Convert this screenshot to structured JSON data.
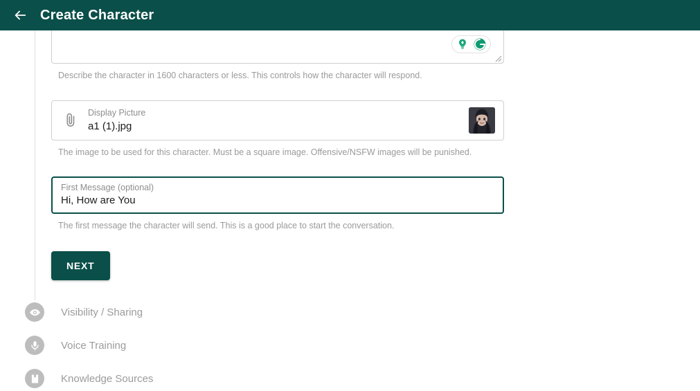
{
  "appbar": {
    "back_icon": "arrow-left-icon",
    "title": "Create Character",
    "bg_color": "#0a4f49"
  },
  "form": {
    "description": {
      "helper": "Describe the character in 1600 characters or less. This controls how the character will respond.",
      "value": "",
      "assistant_pill": {
        "idea_icon": "lightbulb-icon",
        "grammarly_icon": "grammarly-g-icon",
        "accent_color": "#15a67a"
      },
      "resize_handle": "resize-grip-icon"
    },
    "display_picture": {
      "attachment_icon": "paperclip-icon",
      "label": "Display Picture",
      "value": "a1 (1).jpg",
      "helper": "The image to be used for this character. Must be a square image. Offensive/NSFW images will be punished.",
      "thumbnail_alt": "character-portrait"
    },
    "first_message": {
      "label": "First Message (optional)",
      "value": "Hi, How are You",
      "placeholder": "First Message (optional)",
      "helper": "The first message the character will send. This is a good place to start the conversation.",
      "focused": true,
      "focus_color": "#0a4f49"
    },
    "next_button": {
      "label": "NEXT",
      "bg_color": "#0a4f49"
    }
  },
  "steps": [
    {
      "label": "Visibility / Sharing",
      "icon": "eye-icon"
    },
    {
      "label": "Voice Training",
      "icon": "microphone-icon"
    },
    {
      "label": "Knowledge Sources",
      "icon": "book-icon"
    }
  ]
}
